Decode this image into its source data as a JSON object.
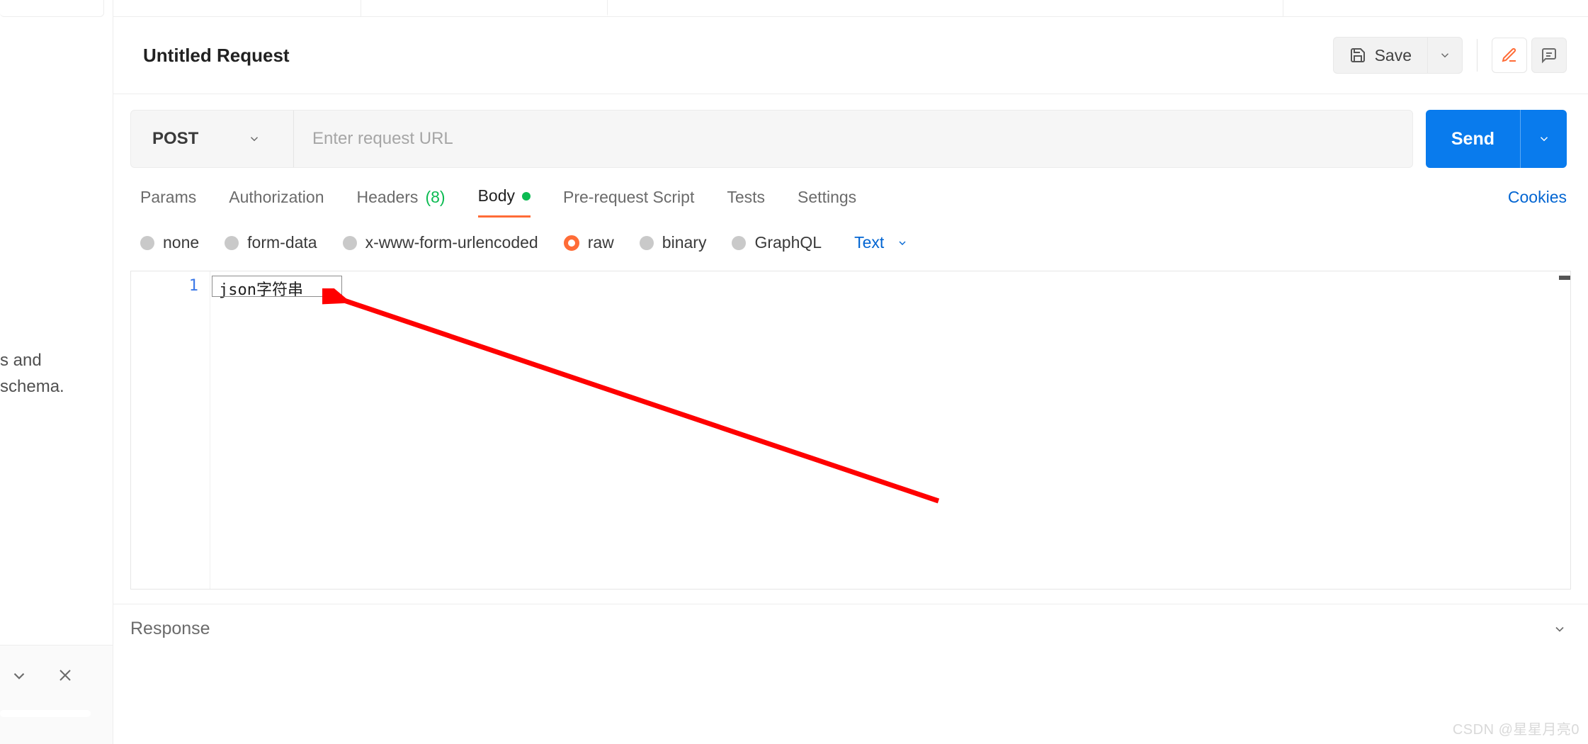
{
  "sidebar": {
    "hint_line1": "s and",
    "hint_line2": "schema."
  },
  "header": {
    "title": "Untitled Request",
    "save_label": "Save"
  },
  "request": {
    "method": "POST",
    "url_placeholder": "Enter request URL",
    "send_label": "Send"
  },
  "tabs": {
    "params": "Params",
    "authorization": "Authorization",
    "headers": "Headers",
    "headers_count": "(8)",
    "body": "Body",
    "prerequest": "Pre-request Script",
    "tests": "Tests",
    "settings": "Settings",
    "cookies": "Cookies"
  },
  "body_types": {
    "none": "none",
    "formdata": "form-data",
    "xwww": "x-www-form-urlencoded",
    "raw": "raw",
    "binary": "binary",
    "graphql": "GraphQL",
    "format": "Text"
  },
  "editor": {
    "line_number": "1",
    "content": "json字符串"
  },
  "response": {
    "label": "Response"
  },
  "watermark": "CSDN @星星月亮0"
}
